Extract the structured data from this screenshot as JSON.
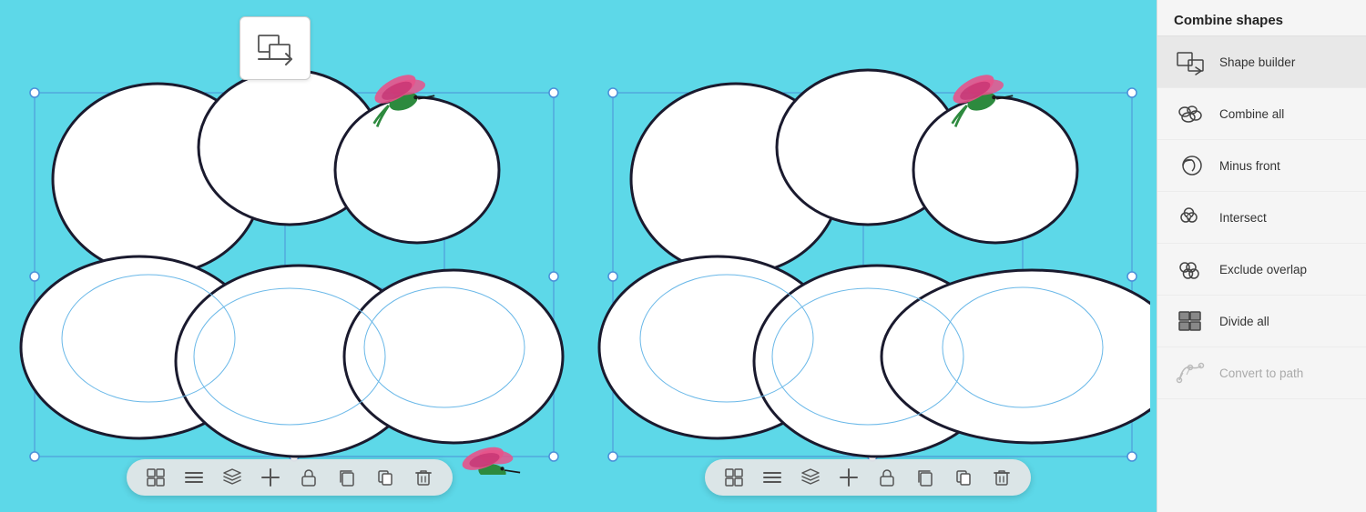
{
  "sidebar": {
    "title": "Combine shapes",
    "items": [
      {
        "id": "shape-builder",
        "label": "Shape builder",
        "active": true,
        "disabled": false
      },
      {
        "id": "combine-all",
        "label": "Combine all",
        "active": false,
        "disabled": false
      },
      {
        "id": "minus-front",
        "label": "Minus front",
        "active": false,
        "disabled": false
      },
      {
        "id": "intersect",
        "label": "Intersect",
        "active": false,
        "disabled": false
      },
      {
        "id": "exclude-overlap",
        "label": "Exclude overlap",
        "active": false,
        "disabled": false
      },
      {
        "id": "divide-all",
        "label": "Divide all",
        "active": false,
        "disabled": false
      },
      {
        "id": "convert-to-path",
        "label": "Convert to path",
        "active": false,
        "disabled": true
      }
    ]
  },
  "toolbar": {
    "icons": [
      "grid",
      "menu",
      "layers",
      "add",
      "lock",
      "copy",
      "duplicate",
      "delete"
    ]
  }
}
